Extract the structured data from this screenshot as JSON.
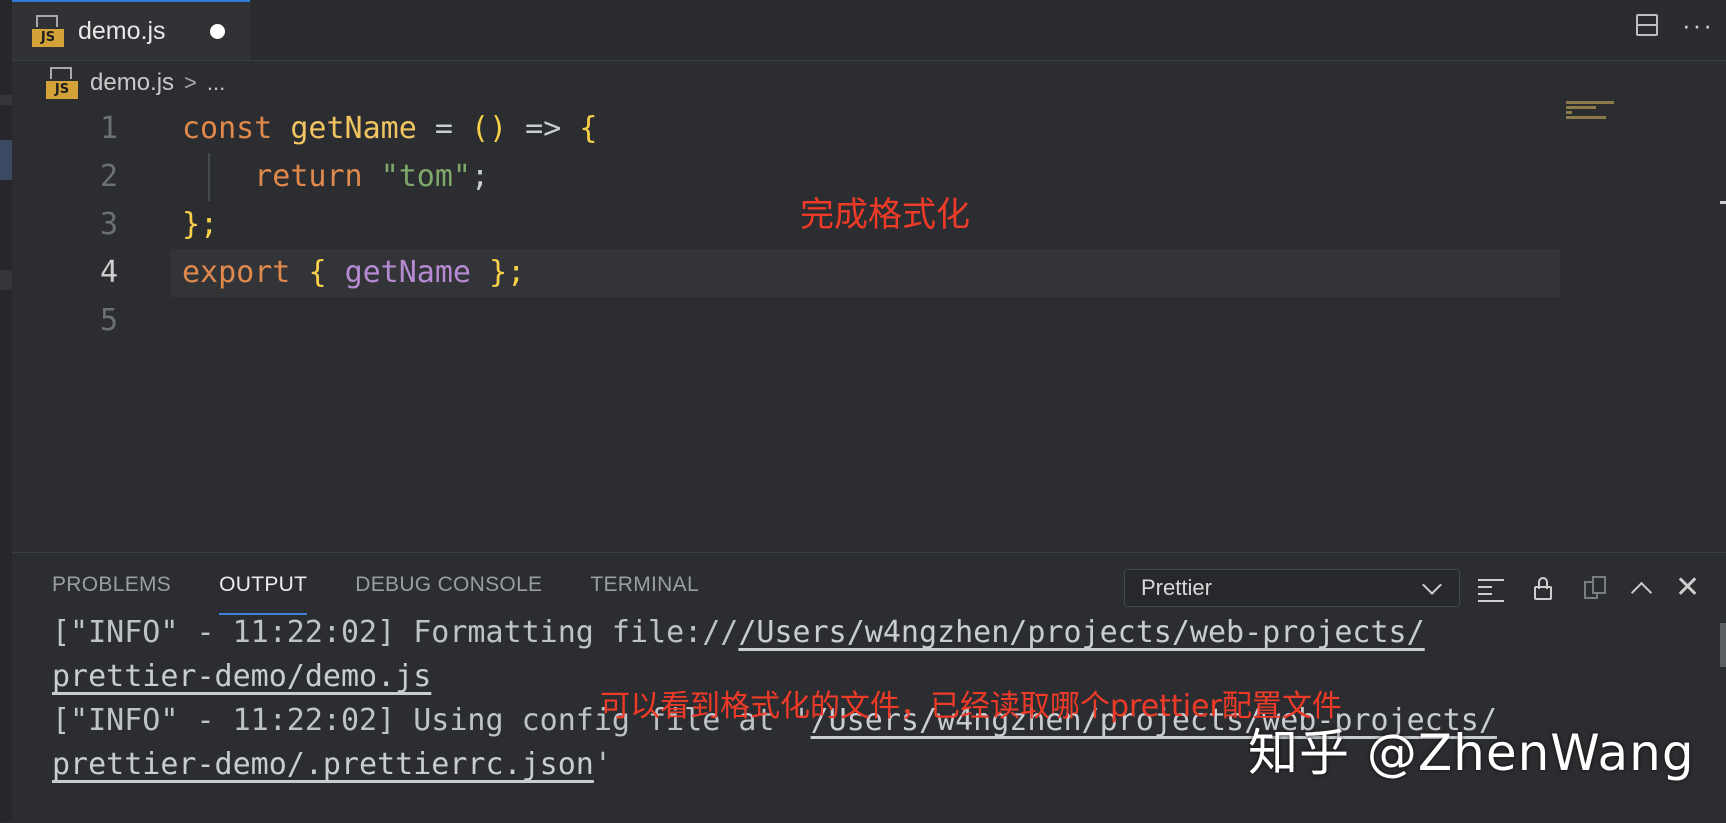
{
  "tab": {
    "title": "demo.js",
    "icon": "js-file-icon",
    "badge": "JS"
  },
  "breadcrumb": {
    "file": "demo.js",
    "separator": ">",
    "more": "..."
  },
  "editor": {
    "line_numbers": [
      "1",
      "2",
      "3",
      "4",
      "5"
    ],
    "active_line": "4",
    "code": {
      "l1": {
        "kw": "const",
        "fn": "getName",
        "eq": " = ",
        "parens": "()",
        "arrow": " => ",
        "brace": "{"
      },
      "l2": {
        "kw": "return",
        "str": "\"tom\"",
        "semi": ";"
      },
      "l3": {
        "brace": "};"
      },
      "l4": {
        "kw": "export",
        "open": "{",
        "var": "getName",
        "close": "};"
      }
    },
    "annotation": "完成格式化"
  },
  "panel": {
    "tabs": [
      "PROBLEMS",
      "OUTPUT",
      "DEBUG CONSOLE",
      "TERMINAL"
    ],
    "active_tab": "OUTPUT",
    "output_channel": "Prettier",
    "lines": {
      "l1_prefix": "[\"INFO\" - 11:22:02] Formatting file://",
      "l1_link": "/Users/w4ngzhen/projects/web-projects/",
      "l2_link": "prettier-demo/demo.js",
      "l3_prefix": "[\"INFO\" - 11:22:02] Using config file at '",
      "l3_link": "/Users/w4ngzhen/projects/web-projects/",
      "l4_link": "prettier-demo/.prettierrc.json",
      "l4_suffix": "'"
    },
    "annotation": "可以看到格式化的文件，已经读取哪个prettier配置文件"
  },
  "watermark": "知乎 @ZhenWang",
  "colors": {
    "accent": "#2f7bd8",
    "annotation": "#ef3a28",
    "keyword": "#e0894c",
    "function": "#f1c462",
    "string": "#7fa86b",
    "variable": "#b68ad2"
  }
}
